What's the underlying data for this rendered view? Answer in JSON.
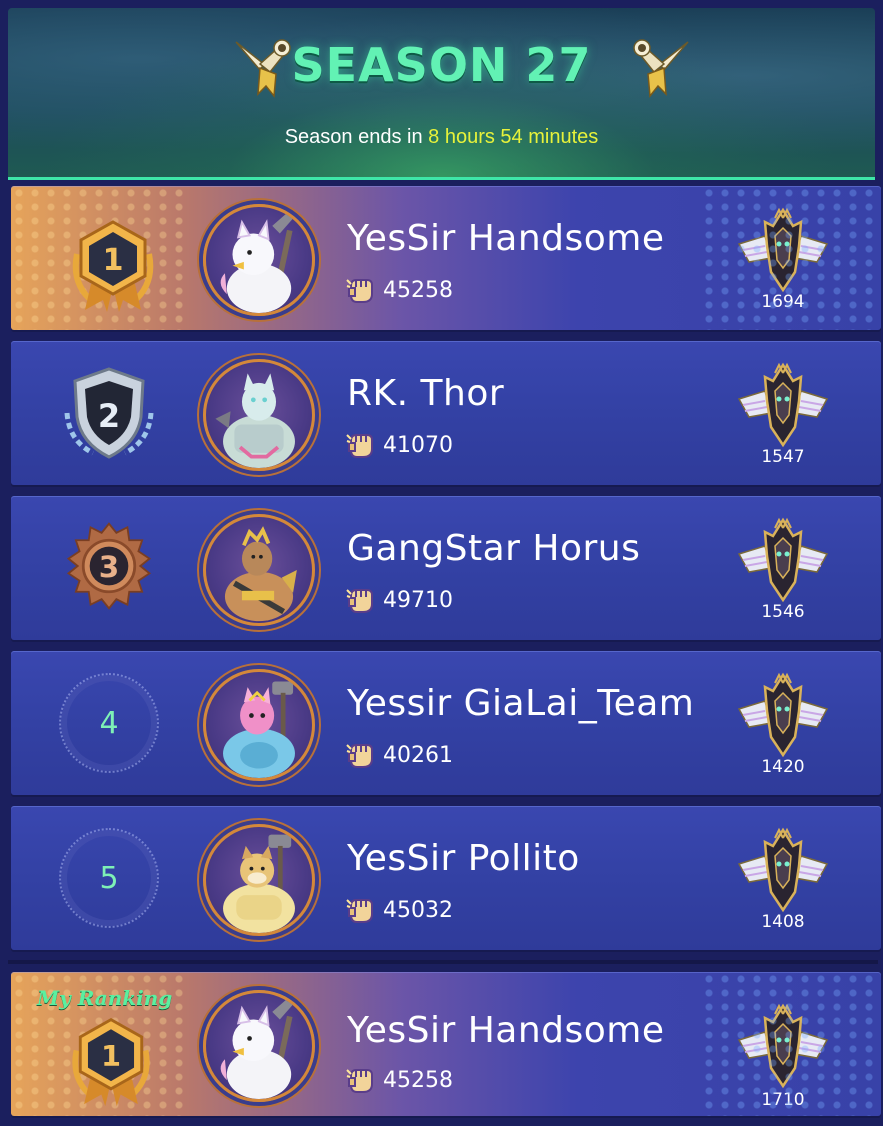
{
  "header": {
    "title": "SEASON 27",
    "subtitle_prefix": "Season ends in ",
    "subtitle_time": "8 hours 54 minutes"
  },
  "rows": [
    {
      "rank": "1",
      "name": "YesSir Handsome",
      "score": "45258",
      "emblem_value": "1694"
    },
    {
      "rank": "2",
      "name": "RK. Thor",
      "score": "41070",
      "emblem_value": "1547"
    },
    {
      "rank": "3",
      "name": "GangStar Horus",
      "score": "49710",
      "emblem_value": "1546"
    },
    {
      "rank": "4",
      "name": "Yessir GiaLai_Team",
      "score": "40261",
      "emblem_value": "1420"
    },
    {
      "rank": "5",
      "name": "YesSir Pollito",
      "score": "45032",
      "emblem_value": "1408"
    }
  ],
  "my_ranking": {
    "label": "My Ranking",
    "rank": "1",
    "name": "YesSir Handsome",
    "score": "45258",
    "emblem_value": "1710"
  },
  "colors": {
    "title": "#62f2b4",
    "time": "#e7f23a",
    "row_bg": "#3341a4",
    "gold": "#e6a45a",
    "rank_number": "#7ef0b6"
  },
  "icons": {
    "trumpet": "trumpet-icon",
    "score": "fist-icon",
    "emblem": "rank-emblem-icon",
    "medal_gold": "gold-medal-icon",
    "medal_silver": "silver-shield-icon",
    "medal_bronze": "bronze-medal-icon"
  }
}
